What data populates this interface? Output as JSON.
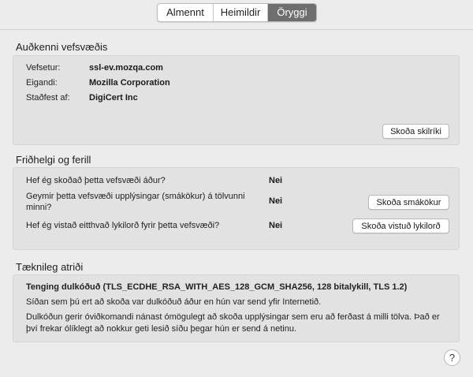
{
  "tabs": [
    "Almennt",
    "Heimildir",
    "Öryggi"
  ],
  "active_tab": "Öryggi",
  "identity": {
    "title": "Auðkenni vefsvæðis",
    "rows": [
      {
        "label": "Vefsetur:",
        "value": "ssl-ev.mozqa.com"
      },
      {
        "label": "Eigandi:",
        "value": "Mozilla Corporation"
      },
      {
        "label": "Staðfest af:",
        "value": "DigiCert Inc"
      }
    ],
    "view_certificate": "Skoða skilríki"
  },
  "privacy": {
    "title": "Friðhelgi og ferill",
    "q1": "Hef ég skoðað þetta vefsvæði áður?",
    "a1": "Nei",
    "q2": "Geymir þetta vefsvæði upplýsingar (smákökur) á tölvunni minni?",
    "a2": "Nei",
    "cookies_button": "Skoða smákökur",
    "q3": "Hef ég vistað eitthvað lykilorð fyrir þetta vefsvæði?",
    "a3": "Nei",
    "passwords_button": "Skoða vistuð lykilorð"
  },
  "technical": {
    "title": "Tæknileg atriði",
    "connection": "Tenging dulkóðuð (TLS_ECDHE_RSA_WITH_AES_128_GCM_SHA256, 128 bitalykill, TLS 1.2)",
    "line1": "Síðan sem þú ert að skoða var dulkóðuð áður en hún var send yfir Internetið.",
    "line2": "Dulkóðun gerir óviðkomandi nánast ómögulegt að skoða upplýsingar sem eru að ferðast á milli tölva. Það er því frekar ólíklegt að nokkur geti lesið síðu þegar hún er send á netinu."
  },
  "help": "?"
}
